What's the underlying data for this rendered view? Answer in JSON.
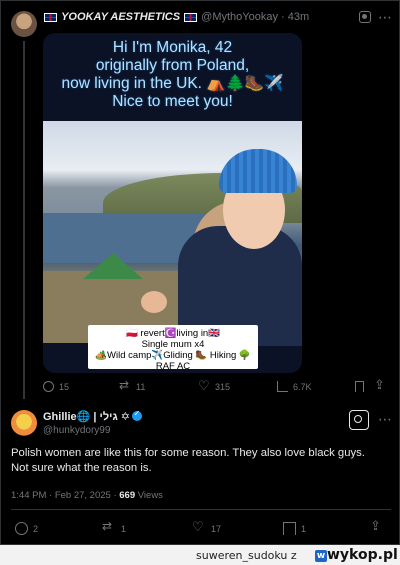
{
  "quoted_tweet": {
    "display_name": "YOOKAY AESTHETICS",
    "handle": "@MythoYookay",
    "time": "43m",
    "caption_lines": [
      "Hi I'm Monika, 42",
      "originally from Poland,",
      "now living in the UK. ⛺🌲🥾✈️",
      "Nice to meet you!"
    ],
    "bio_lines": [
      "🇵🇱 revert☪️living in🇬🇧",
      "Single mum x4",
      "🏕️Wild camp✈️Gliding 🥾 Hiking 🌳 RAF AC"
    ],
    "stats": {
      "replies": "15",
      "reposts": "11",
      "likes": "315",
      "views": "6.7K"
    }
  },
  "main_tweet": {
    "display_name": "Ghillie🌐 | גילי ✡",
    "handle": "@hunkydory99",
    "text": "Polish women are like this for some reason. They also love black guys. Not sure what the reason is.",
    "timestamp": "1:44 PM · Feb 27, 2025 · ",
    "views_count": "669",
    "views_label": " Views",
    "stats": {
      "replies": "2",
      "reposts": "1",
      "likes": "17",
      "bookmarks": "1"
    }
  },
  "footer": {
    "username": "suweren_sudoku",
    "z_label": "z",
    "logo": "wykop.pl"
  },
  "icons": {
    "more": "more-icon",
    "grok": "grok-icon",
    "verified": "verified-badge-icon"
  },
  "colors": {
    "background": "#000000",
    "secondary_text": "#71767b",
    "verified": "#1d9bf0"
  }
}
